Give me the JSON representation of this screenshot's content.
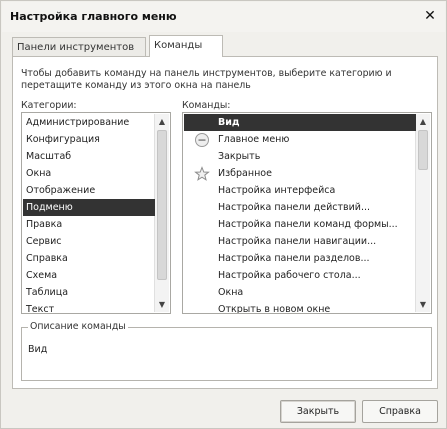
{
  "window": {
    "title": "Настройка главного меню",
    "close_glyph": "✕"
  },
  "tabs": [
    {
      "label": "Панели инструментов"
    },
    {
      "label": "Команды"
    }
  ],
  "hint": "Чтобы добавить команду на панель инструментов, выберите категорию и перетащите команду из этого окна на панель",
  "categories_label": "Категории:",
  "commands_label": "Команды:",
  "categories": [
    "Администрирование",
    "Конфигурация",
    "Масштаб",
    "Окна",
    "Отображение",
    "Подменю",
    "Правка",
    "Сервис",
    "Справка",
    "Схема",
    "Таблица",
    "Текст"
  ],
  "selected_category_index": 5,
  "commands": [
    {
      "label": "Вид",
      "icon": null
    },
    {
      "label": "Главное меню",
      "icon": "main-menu-circle-icon"
    },
    {
      "label": "Закрыть",
      "icon": null
    },
    {
      "label": "Избранное",
      "icon": "favorites-star-icon"
    },
    {
      "label": "Настройка интерфейса",
      "icon": null
    },
    {
      "label": "Настройка панели действий...",
      "icon": null
    },
    {
      "label": "Настройка панели команд формы...",
      "icon": null
    },
    {
      "label": "Настройка панели навигации...",
      "icon": null
    },
    {
      "label": "Настройка панели разделов...",
      "icon": null
    },
    {
      "label": "Настройка рабочего стола...",
      "icon": null
    },
    {
      "label": "Окна",
      "icon": null
    },
    {
      "label": "Открыть в новом окне",
      "icon": null
    }
  ],
  "selected_command_index": 0,
  "description": {
    "title": "Описание команды",
    "text": "Вид"
  },
  "buttons": {
    "close": "Закрыть",
    "help": "Справка"
  },
  "colors": {
    "selection": "#333333",
    "dialog_bg": "#f1f0ec"
  }
}
